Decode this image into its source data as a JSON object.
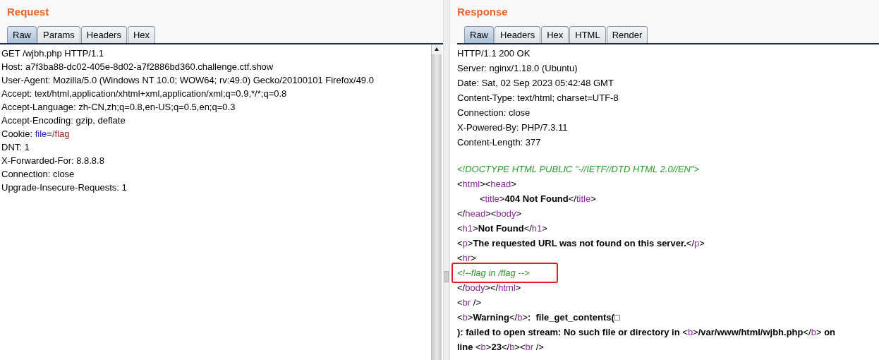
{
  "request": {
    "title": "Request",
    "tabs": [
      {
        "label": "Raw",
        "selected": true
      },
      {
        "label": "Params",
        "selected": false
      },
      {
        "label": "Headers",
        "selected": false
      },
      {
        "label": "Hex",
        "selected": false
      }
    ],
    "lines": [
      {
        "segments": [
          {
            "kind": "plain",
            "text": "GET /wjbh.php HTTP/1.1"
          }
        ]
      },
      {
        "segments": [
          {
            "kind": "plain",
            "text": "Host: a7f3ba88-dc02-405e-8d02-a7f2886bd360.challenge.ctf.show"
          }
        ]
      },
      {
        "segments": [
          {
            "kind": "plain",
            "text": "User-Agent: Mozilla/5.0 (Windows NT 10.0; WOW64; rv:49.0) Gecko/20100101 Firefox/49.0"
          }
        ]
      },
      {
        "segments": [
          {
            "kind": "plain",
            "text": "Accept: text/html,application/xhtml+xml,application/xml;q=0.9,*/*;q=0.8"
          }
        ]
      },
      {
        "segments": [
          {
            "kind": "plain",
            "text": "Accept-Language: zh-CN,zh;q=0.8,en-US;q=0.5,en;q=0.3"
          }
        ]
      },
      {
        "segments": [
          {
            "kind": "plain",
            "text": "Accept-Encoding: gzip, deflate"
          }
        ]
      },
      {
        "segments": [
          {
            "kind": "plain",
            "text": "Cookie: "
          },
          {
            "kind": "name",
            "text": "file"
          },
          {
            "kind": "plain",
            "text": "="
          },
          {
            "kind": "value",
            "text": "/flag"
          }
        ]
      },
      {
        "segments": [
          {
            "kind": "plain",
            "text": "DNT: 1"
          }
        ]
      },
      {
        "segments": [
          {
            "kind": "plain",
            "text": "X-Forwarded-For: 8.8.8.8"
          }
        ]
      },
      {
        "segments": [
          {
            "kind": "plain",
            "text": "Connection: close"
          }
        ]
      },
      {
        "segments": [
          {
            "kind": "plain",
            "text": "Upgrade-Insecure-Requests: 1"
          }
        ]
      }
    ]
  },
  "response": {
    "title": "Response",
    "tabs": [
      {
        "label": "Raw",
        "selected": true
      },
      {
        "label": "Headers",
        "selected": false
      },
      {
        "label": "Hex",
        "selected": false
      },
      {
        "label": "HTML",
        "selected": false
      },
      {
        "label": "Render",
        "selected": false
      }
    ],
    "lines": [
      {
        "indented": false,
        "highlighted": false,
        "segments": [
          {
            "kind": "plain",
            "text": "HTTP/1.1 200 OK"
          }
        ]
      },
      {
        "indented": false,
        "highlighted": false,
        "segments": [
          {
            "kind": "plain",
            "text": "Server: nginx/1.18.0 (Ubuntu)"
          }
        ]
      },
      {
        "indented": false,
        "highlighted": false,
        "segments": [
          {
            "kind": "plain",
            "text": "Date: Sat, 02 Sep 2023 05:42:48 GMT"
          }
        ]
      },
      {
        "indented": false,
        "highlighted": false,
        "segments": [
          {
            "kind": "plain",
            "text": "Content-Type: text/html; charset=UTF-8"
          }
        ]
      },
      {
        "indented": false,
        "highlighted": false,
        "segments": [
          {
            "kind": "plain",
            "text": "Connection: close"
          }
        ]
      },
      {
        "indented": false,
        "highlighted": false,
        "segments": [
          {
            "kind": "plain",
            "text": "X-Powered-By: PHP/7.3.11"
          }
        ]
      },
      {
        "indented": false,
        "highlighted": false,
        "segments": [
          {
            "kind": "plain",
            "text": "Content-Length: 377"
          }
        ]
      },
      {
        "segments": [
          {
            "kind": "blank"
          }
        ]
      },
      {
        "indented": false,
        "highlighted": false,
        "segments": [
          {
            "kind": "comment",
            "text": "<!DOCTYPE HTML PUBLIC \"-//IETF//DTD HTML 2.0//EN\">"
          }
        ]
      },
      {
        "indented": false,
        "highlighted": false,
        "segments": [
          {
            "kind": "plain",
            "text": "<"
          },
          {
            "kind": "tag",
            "text": "html"
          },
          {
            "kind": "plain",
            "text": "><"
          },
          {
            "kind": "tag",
            "text": "head"
          },
          {
            "kind": "plain",
            "text": ">"
          }
        ]
      },
      {
        "indented": true,
        "highlighted": false,
        "segments": [
          {
            "kind": "plain",
            "text": "<"
          },
          {
            "kind": "tag",
            "text": "title"
          },
          {
            "kind": "plain",
            "text": ">"
          },
          {
            "kind": "bold",
            "text": "404 Not Found"
          },
          {
            "kind": "plain",
            "text": "</"
          },
          {
            "kind": "tag",
            "text": "title"
          },
          {
            "kind": "plain",
            "text": ">"
          }
        ]
      },
      {
        "indented": false,
        "highlighted": false,
        "segments": [
          {
            "kind": "plain",
            "text": "</"
          },
          {
            "kind": "tag",
            "text": "head"
          },
          {
            "kind": "plain",
            "text": "><"
          },
          {
            "kind": "tag",
            "text": "body"
          },
          {
            "kind": "plain",
            "text": ">"
          }
        ]
      },
      {
        "indented": false,
        "highlighted": false,
        "segments": [
          {
            "kind": "plain",
            "text": "<"
          },
          {
            "kind": "tag",
            "text": "h1"
          },
          {
            "kind": "plain",
            "text": ">"
          },
          {
            "kind": "bold",
            "text": "Not Found"
          },
          {
            "kind": "plain",
            "text": "</"
          },
          {
            "kind": "tag",
            "text": "h1"
          },
          {
            "kind": "plain",
            "text": ">"
          }
        ]
      },
      {
        "indented": false,
        "highlighted": false,
        "segments": [
          {
            "kind": "plain",
            "text": "<"
          },
          {
            "kind": "tag",
            "text": "p"
          },
          {
            "kind": "plain",
            "text": ">"
          },
          {
            "kind": "bold",
            "text": "The requested URL was not found on this server."
          },
          {
            "kind": "plain",
            "text": "</"
          },
          {
            "kind": "tag",
            "text": "p"
          },
          {
            "kind": "plain",
            "text": ">"
          }
        ]
      },
      {
        "indented": false,
        "highlighted": false,
        "segments": [
          {
            "kind": "plain",
            "text": "<"
          },
          {
            "kind": "tag",
            "text": "hr"
          },
          {
            "kind": "plain",
            "text": ">"
          }
        ]
      },
      {
        "indented": false,
        "highlighted": true,
        "segments": [
          {
            "kind": "comment",
            "text": "<!--flag in /flag -->"
          }
        ]
      },
      {
        "indented": false,
        "highlighted": false,
        "segments": [
          {
            "kind": "plain",
            "text": "</"
          },
          {
            "kind": "tag",
            "text": "body"
          },
          {
            "kind": "plain",
            "text": "></"
          },
          {
            "kind": "tag",
            "text": "html"
          },
          {
            "kind": "plain",
            "text": ">"
          }
        ]
      },
      {
        "indented": false,
        "highlighted": false,
        "segments": [
          {
            "kind": "plain",
            "text": "<"
          },
          {
            "kind": "tag",
            "text": "br"
          },
          {
            "kind": "plain",
            "text": " />"
          }
        ]
      },
      {
        "indented": false,
        "highlighted": false,
        "segments": [
          {
            "kind": "plain",
            "text": "<"
          },
          {
            "kind": "tag",
            "text": "b"
          },
          {
            "kind": "plain",
            "text": ">"
          },
          {
            "kind": "bold",
            "text": "Warning"
          },
          {
            "kind": "plain",
            "text": "</"
          },
          {
            "kind": "tag",
            "text": "b"
          },
          {
            "kind": "plain",
            "text": ">"
          },
          {
            "kind": "bold",
            "text": ":  file_get_contents(□"
          }
        ]
      },
      {
        "indented": false,
        "highlighted": false,
        "segments": [
          {
            "kind": "bold",
            "text": "): failed to open stream: No such file or directory in "
          },
          {
            "kind": "plain",
            "text": "<"
          },
          {
            "kind": "tag",
            "text": "b"
          },
          {
            "kind": "plain",
            "text": ">"
          },
          {
            "kind": "bold",
            "text": "/var/www/html/wjbh.php"
          },
          {
            "kind": "plain",
            "text": "</"
          },
          {
            "kind": "tag",
            "text": "b"
          },
          {
            "kind": "plain",
            "text": ">"
          },
          {
            "kind": "bold",
            "text": " on"
          }
        ]
      },
      {
        "indented": false,
        "highlighted": false,
        "segments": [
          {
            "kind": "bold",
            "text": "line "
          },
          {
            "kind": "plain",
            "text": "<"
          },
          {
            "kind": "tag",
            "text": "b"
          },
          {
            "kind": "plain",
            "text": ">"
          },
          {
            "kind": "bold",
            "text": "23"
          },
          {
            "kind": "plain",
            "text": "</"
          },
          {
            "kind": "tag",
            "text": "b"
          },
          {
            "kind": "plain",
            "text": "><"
          },
          {
            "kind": "tag",
            "text": "br"
          },
          {
            "kind": "plain",
            "text": " />"
          }
        ]
      }
    ]
  }
}
